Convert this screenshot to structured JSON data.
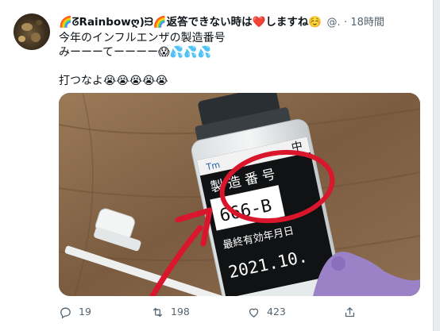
{
  "tweet": {
    "author": {
      "display_name": "🌈ᘔRainbowღ)ᙣ🌈返答できない時は❤️しますね☺️",
      "handle": "@.",
      "avatar_icon": "avatar-icon"
    },
    "separator": "·",
    "timestamp": "18時間",
    "text_lines": [
      "今年のインフルエンザの製造番号",
      "みーーーてーーーー😱💦💦💦",
      "",
      "打つなよ😭😭😭😭😭"
    ],
    "media": {
      "label_top": "製造番号",
      "label_code": "666-B",
      "label_expiry": "最終有効年月日",
      "label_date": "2021.10.",
      "label_side": "中"
    },
    "actions": {
      "reply_count": "19",
      "retweet_count": "198",
      "like_count": "423"
    },
    "colors": {
      "accent_red": "#d9162b",
      "muted_text": "#536471"
    }
  }
}
